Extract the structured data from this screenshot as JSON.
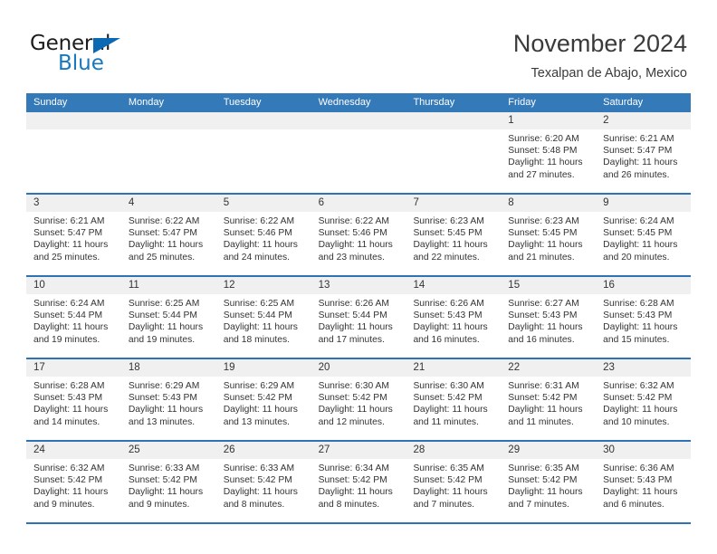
{
  "brand": {
    "name_part1": "General",
    "name_part2": "Blue",
    "triangle_icon": "blue-triangle-icon",
    "accent_color": "#1878be"
  },
  "header": {
    "month_title": "November 2024",
    "location": "Texalpan de Abajo, Mexico"
  },
  "calendar": {
    "header_color": "#3479b8",
    "daynum_band_color": "#f0f0f0",
    "row_border_color": "#2e73b4",
    "weekdays": [
      "Sunday",
      "Monday",
      "Tuesday",
      "Wednesday",
      "Thursday",
      "Friday",
      "Saturday"
    ],
    "weeks": [
      [
        {
          "day": "",
          "empty": true
        },
        {
          "day": "",
          "empty": true
        },
        {
          "day": "",
          "empty": true
        },
        {
          "day": "",
          "empty": true
        },
        {
          "day": "",
          "empty": true
        },
        {
          "day": "1",
          "sunrise": "Sunrise: 6:20 AM",
          "sunset": "Sunset: 5:48 PM",
          "daylight_line1": "Daylight: 11 hours",
          "daylight_line2": "and 27 minutes."
        },
        {
          "day": "2",
          "sunrise": "Sunrise: 6:21 AM",
          "sunset": "Sunset: 5:47 PM",
          "daylight_line1": "Daylight: 11 hours",
          "daylight_line2": "and 26 minutes."
        }
      ],
      [
        {
          "day": "3",
          "sunrise": "Sunrise: 6:21 AM",
          "sunset": "Sunset: 5:47 PM",
          "daylight_line1": "Daylight: 11 hours",
          "daylight_line2": "and 25 minutes."
        },
        {
          "day": "4",
          "sunrise": "Sunrise: 6:22 AM",
          "sunset": "Sunset: 5:47 PM",
          "daylight_line1": "Daylight: 11 hours",
          "daylight_line2": "and 25 minutes."
        },
        {
          "day": "5",
          "sunrise": "Sunrise: 6:22 AM",
          "sunset": "Sunset: 5:46 PM",
          "daylight_line1": "Daylight: 11 hours",
          "daylight_line2": "and 24 minutes."
        },
        {
          "day": "6",
          "sunrise": "Sunrise: 6:22 AM",
          "sunset": "Sunset: 5:46 PM",
          "daylight_line1": "Daylight: 11 hours",
          "daylight_line2": "and 23 minutes."
        },
        {
          "day": "7",
          "sunrise": "Sunrise: 6:23 AM",
          "sunset": "Sunset: 5:45 PM",
          "daylight_line1": "Daylight: 11 hours",
          "daylight_line2": "and 22 minutes."
        },
        {
          "day": "8",
          "sunrise": "Sunrise: 6:23 AM",
          "sunset": "Sunset: 5:45 PM",
          "daylight_line1": "Daylight: 11 hours",
          "daylight_line2": "and 21 minutes."
        },
        {
          "day": "9",
          "sunrise": "Sunrise: 6:24 AM",
          "sunset": "Sunset: 5:45 PM",
          "daylight_line1": "Daylight: 11 hours",
          "daylight_line2": "and 20 minutes."
        }
      ],
      [
        {
          "day": "10",
          "sunrise": "Sunrise: 6:24 AM",
          "sunset": "Sunset: 5:44 PM",
          "daylight_line1": "Daylight: 11 hours",
          "daylight_line2": "and 19 minutes."
        },
        {
          "day": "11",
          "sunrise": "Sunrise: 6:25 AM",
          "sunset": "Sunset: 5:44 PM",
          "daylight_line1": "Daylight: 11 hours",
          "daylight_line2": "and 19 minutes."
        },
        {
          "day": "12",
          "sunrise": "Sunrise: 6:25 AM",
          "sunset": "Sunset: 5:44 PM",
          "daylight_line1": "Daylight: 11 hours",
          "daylight_line2": "and 18 minutes."
        },
        {
          "day": "13",
          "sunrise": "Sunrise: 6:26 AM",
          "sunset": "Sunset: 5:44 PM",
          "daylight_line1": "Daylight: 11 hours",
          "daylight_line2": "and 17 minutes."
        },
        {
          "day": "14",
          "sunrise": "Sunrise: 6:26 AM",
          "sunset": "Sunset: 5:43 PM",
          "daylight_line1": "Daylight: 11 hours",
          "daylight_line2": "and 16 minutes."
        },
        {
          "day": "15",
          "sunrise": "Sunrise: 6:27 AM",
          "sunset": "Sunset: 5:43 PM",
          "daylight_line1": "Daylight: 11 hours",
          "daylight_line2": "and 16 minutes."
        },
        {
          "day": "16",
          "sunrise": "Sunrise: 6:28 AM",
          "sunset": "Sunset: 5:43 PM",
          "daylight_line1": "Daylight: 11 hours",
          "daylight_line2": "and 15 minutes."
        }
      ],
      [
        {
          "day": "17",
          "sunrise": "Sunrise: 6:28 AM",
          "sunset": "Sunset: 5:43 PM",
          "daylight_line1": "Daylight: 11 hours",
          "daylight_line2": "and 14 minutes."
        },
        {
          "day": "18",
          "sunrise": "Sunrise: 6:29 AM",
          "sunset": "Sunset: 5:43 PM",
          "daylight_line1": "Daylight: 11 hours",
          "daylight_line2": "and 13 minutes."
        },
        {
          "day": "19",
          "sunrise": "Sunrise: 6:29 AM",
          "sunset": "Sunset: 5:42 PM",
          "daylight_line1": "Daylight: 11 hours",
          "daylight_line2": "and 13 minutes."
        },
        {
          "day": "20",
          "sunrise": "Sunrise: 6:30 AM",
          "sunset": "Sunset: 5:42 PM",
          "daylight_line1": "Daylight: 11 hours",
          "daylight_line2": "and 12 minutes."
        },
        {
          "day": "21",
          "sunrise": "Sunrise: 6:30 AM",
          "sunset": "Sunset: 5:42 PM",
          "daylight_line1": "Daylight: 11 hours",
          "daylight_line2": "and 11 minutes."
        },
        {
          "day": "22",
          "sunrise": "Sunrise: 6:31 AM",
          "sunset": "Sunset: 5:42 PM",
          "daylight_line1": "Daylight: 11 hours",
          "daylight_line2": "and 11 minutes."
        },
        {
          "day": "23",
          "sunrise": "Sunrise: 6:32 AM",
          "sunset": "Sunset: 5:42 PM",
          "daylight_line1": "Daylight: 11 hours",
          "daylight_line2": "and 10 minutes."
        }
      ],
      [
        {
          "day": "24",
          "sunrise": "Sunrise: 6:32 AM",
          "sunset": "Sunset: 5:42 PM",
          "daylight_line1": "Daylight: 11 hours",
          "daylight_line2": "and 9 minutes."
        },
        {
          "day": "25",
          "sunrise": "Sunrise: 6:33 AM",
          "sunset": "Sunset: 5:42 PM",
          "daylight_line1": "Daylight: 11 hours",
          "daylight_line2": "and 9 minutes."
        },
        {
          "day": "26",
          "sunrise": "Sunrise: 6:33 AM",
          "sunset": "Sunset: 5:42 PM",
          "daylight_line1": "Daylight: 11 hours",
          "daylight_line2": "and 8 minutes."
        },
        {
          "day": "27",
          "sunrise": "Sunrise: 6:34 AM",
          "sunset": "Sunset: 5:42 PM",
          "daylight_line1": "Daylight: 11 hours",
          "daylight_line2": "and 8 minutes."
        },
        {
          "day": "28",
          "sunrise": "Sunrise: 6:35 AM",
          "sunset": "Sunset: 5:42 PM",
          "daylight_line1": "Daylight: 11 hours",
          "daylight_line2": "and 7 minutes."
        },
        {
          "day": "29",
          "sunrise": "Sunrise: 6:35 AM",
          "sunset": "Sunset: 5:42 PM",
          "daylight_line1": "Daylight: 11 hours",
          "daylight_line2": "and 7 minutes."
        },
        {
          "day": "30",
          "sunrise": "Sunrise: 6:36 AM",
          "sunset": "Sunset: 5:43 PM",
          "daylight_line1": "Daylight: 11 hours",
          "daylight_line2": "and 6 minutes."
        }
      ]
    ]
  }
}
